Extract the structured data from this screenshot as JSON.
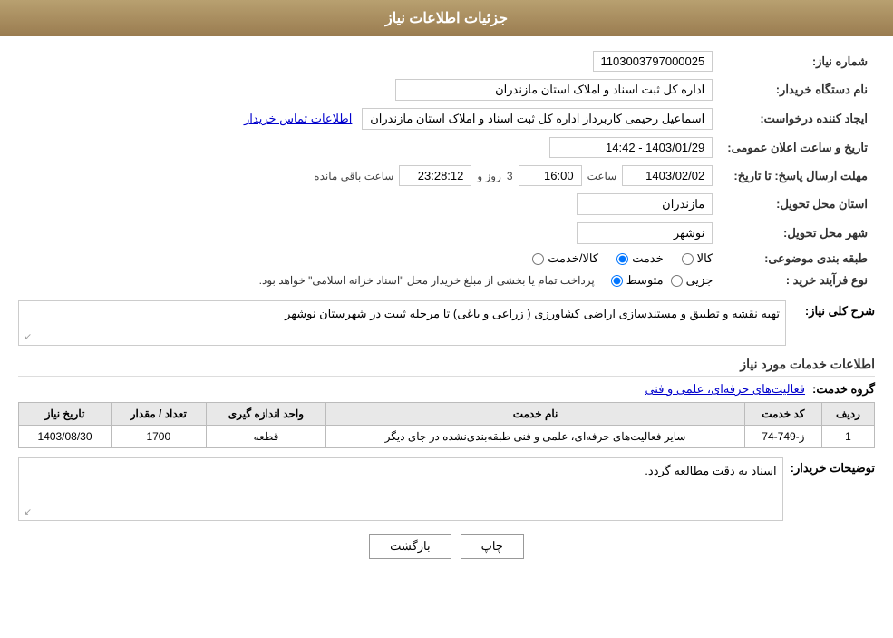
{
  "header": {
    "title": "جزئیات اطلاعات نیاز"
  },
  "fields": {
    "request_number_label": "شماره نیاز:",
    "request_number_value": "1103003797000025",
    "buyer_org_label": "نام دستگاه خریدار:",
    "buyer_org_value": "اداره کل ثبت اسناد و املاک استان مازندران",
    "creator_label": "ایجاد کننده درخواست:",
    "creator_value": "اسماعیل رحیمی کاربرداز اداره کل ثبت اسناد و املاک استان مازندران",
    "creator_link": "اطلاعات تماس خریدار",
    "announce_datetime_label": "تاریخ و ساعت اعلان عمومی:",
    "announce_datetime_value": "1403/01/29 - 14:42",
    "deadline_label": "مهلت ارسال پاسخ: تا تاریخ:",
    "deadline_date": "1403/02/02",
    "deadline_time_label": "ساعت",
    "deadline_time_value": "16:00",
    "deadline_day_label": "روز و",
    "deadline_day_value": "3",
    "deadline_remaining_label": "ساعت باقی مانده",
    "deadline_remaining_value": "23:28:12",
    "province_label": "استان محل تحویل:",
    "province_value": "مازندران",
    "city_label": "شهر محل تحویل:",
    "city_value": "نوشهر",
    "category_label": "طبقه بندی موضوعی:",
    "category_options": [
      {
        "label": "کالا",
        "value": "kala"
      },
      {
        "label": "خدمت",
        "value": "khedmat"
      },
      {
        "label": "کالا/خدمت",
        "value": "kala_khedmat"
      }
    ],
    "category_selected": "khedmat",
    "purchase_type_label": "نوع فرآیند خرید :",
    "purchase_type_options": [
      {
        "label": "جزیی",
        "value": "jozi"
      },
      {
        "label": "متوسط",
        "value": "motavaset"
      }
    ],
    "purchase_type_selected": "motavaset",
    "purchase_type_note": "پرداخت تمام یا بخشی از مبلغ خریدار محل \"اسناد خزانه اسلامی\" خواهد بود.",
    "description_label": "شرح کلی نیاز:",
    "description_value": "تهیه نقشه و تطبیق و مستندسازی اراضی کشاورزی ( زراعی و باغی) تا مرحله ثبیت در شهرستان نوشهر",
    "services_info_title": "اطلاعات خدمات مورد نیاز",
    "group_service_label": "گروه خدمت:",
    "group_service_value": "فعالیت‌های حرفه‌ای، علمی و فنی",
    "table_headers": {
      "row_num": "ردیف",
      "service_code": "کد خدمت",
      "service_name": "نام خدمت",
      "unit": "واحد اندازه گیری",
      "quantity": "تعداد / مقدار",
      "date": "تاریخ نیاز"
    },
    "table_rows": [
      {
        "row_num": "1",
        "service_code": "ز-749-74",
        "service_name": "سایر فعالیت‌های حرفه‌ای، علمی و فنی طبقه‌بندی‌نشده در جای دیگر",
        "unit": "قطعه",
        "quantity": "1700",
        "date": "1403/08/30"
      }
    ],
    "buyer_notes_label": "توضیحات خریدار:",
    "buyer_notes_value": "اسناد به دقت مطالعه گردد.",
    "btn_print": "چاپ",
    "btn_back": "بازگشت"
  }
}
